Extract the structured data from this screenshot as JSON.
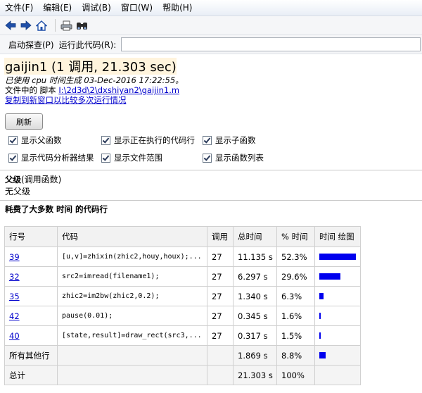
{
  "menu": [
    "文件(F)",
    "编辑(E)",
    "调试(B)",
    "窗口(W)",
    "帮助(H)"
  ],
  "address": {
    "tab_label": "启动探查(P)",
    "run_label": "运行此代码(R):",
    "value": ""
  },
  "header": {
    "title": "gaijin1 (1 调用, 21.303 sec)",
    "generated": "已使用 cpu 时间生成 03-Dec-2016 17:22:55。",
    "script_prefix": "文件中的 脚本 ",
    "script_path": "I:\\2d3d\\2\\dxshiyan2\\gaijin1.m",
    "copy_link": "复制到新窗口以比较多次运行情况"
  },
  "refresh_label": "刷新",
  "options": [
    "显示父函数",
    "显示正在执行的代码行",
    "显示子函数",
    "显示代码分析器结果",
    "显示文件范围",
    "显示函数列表"
  ],
  "parents": {
    "title": "父级",
    "title_suffix": "(调用函数)",
    "value": "无父级"
  },
  "lines_title": "耗费了大多数 时间 的代码行",
  "table": {
    "headers": [
      "行号",
      "代码",
      "调用",
      "总时间",
      "% 时间",
      "时间 绘图"
    ],
    "rows": [
      {
        "line": "39",
        "code": "[u,v]=zhixin(zhic2,houy,houx);...",
        "calls": "27",
        "total": "11.135 s",
        "pct": "52.3%",
        "frac": 0.523
      },
      {
        "line": "32",
        "code": "src2=imread(filename1);",
        "calls": "27",
        "total": "6.297 s",
        "pct": "29.6%",
        "frac": 0.296
      },
      {
        "line": "35",
        "code": "zhic2=im2bw(zhic2,0.2);",
        "calls": "27",
        "total": "1.340 s",
        "pct": "6.3%",
        "frac": 0.063
      },
      {
        "line": "42",
        "code": "pause(0.01);",
        "calls": "27",
        "total": "0.345 s",
        "pct": "1.6%",
        "frac": 0.016
      },
      {
        "line": "40",
        "code": "[state,result]=draw_rect(src3,...",
        "calls": "27",
        "total": "0.317 s",
        "pct": "1.5%",
        "frac": 0.015
      },
      {
        "line": "所有其他行",
        "code": "",
        "calls": "",
        "total": "1.869 s",
        "pct": "8.8%",
        "frac": 0.088
      },
      {
        "line": "总计",
        "code": "",
        "calls": "",
        "total": "21.303 s",
        "pct": "100%",
        "frac": 0
      }
    ]
  }
}
